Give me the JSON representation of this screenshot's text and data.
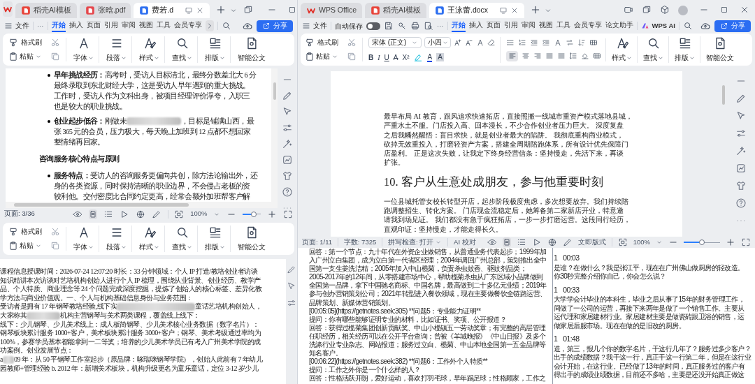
{
  "left_window": {
    "tabs": [
      {
        "label": "稻壳AI模板",
        "kind": "template",
        "selected": false
      },
      {
        "label": "张晗.pdf",
        "kind": "pdf",
        "selected": false
      },
      {
        "label": "费若.d",
        "kind": "word",
        "selected": true
      }
    ],
    "menu": {
      "file": "文件",
      "more": "···",
      "items": [
        {
          "label": "开始",
          "selected": true
        },
        {
          "label": "插入",
          "selected": false
        },
        {
          "label": "页面",
          "selected": false
        },
        {
          "label": "引用",
          "selected": false
        },
        {
          "label": "审阅",
          "selected": false
        },
        {
          "label": "视图",
          "selected": false
        },
        {
          "label": "工具",
          "selected": false
        },
        {
          "label": "会员专享",
          "selected": false
        }
      ],
      "share": "分享"
    },
    "ribbon": {
      "small": [
        "格式刷",
        "粘贴"
      ],
      "groups": [
        {
          "label": "字体",
          "kind": "font",
          "dropdown": true
        },
        {
          "label": "段落",
          "kind": "paragraph",
          "dropdown": true
        },
        {
          "label": "样式",
          "kind": "style",
          "dropdown": true
        },
        {
          "label": "查找",
          "kind": "find",
          "dropdown": true
        },
        {
          "label": "排版",
          "kind": "layout",
          "dropdown": true
        },
        {
          "label": "智能公文",
          "kind": "document",
          "dropdown": false
        }
      ]
    },
    "document": [
      {
        "kind": "bullet",
        "lines": [
          "**早年挑战经历：**高考时，受访人目标清北，最终分数差北大 6 分",
          "最终录取到东北财经大学，这是受访人早年遇到的重大挑战。",
          "工作时，受访人作为文科出身，被项目经理评价浮夸，入职三",
          "也是较大的职业挑战。"
        ]
      },
      {
        "kind": "bullet",
        "lines": [
          {
            "before": "**创业起步低谷：**刚做未",
            "after": "，目标是铺满山西，最"
          },
          "张 365 元的会员，压力极大，每天晚上加班到 12 点都不想回家",
          "整情绪再回家。"
        ]
      },
      {
        "kind": "heading",
        "text": "咨询服务核心特点与原则"
      },
      {
        "kind": "bullet",
        "lines": [
          "**服务特点：**受访人的咨询服务更偏向共创，除方法论输出外，还",
          "身的各类资源，同时保持清晰的职业边界，不会侵占老板的资",
          "较利他。交付密度比合同约定更高，经常会额外加班帮客户解"
        ]
      }
    ],
    "status_bar": {
      "page": "页面: 3/36",
      "zoom": "100%",
      "level": 0.6
    }
  },
  "right_window": {
    "tabs": [
      {
        "label": "WPS Office",
        "kind": "home",
        "selected": false
      },
      {
        "label": "稻壳AI模板",
        "kind": "template",
        "selected": false
      },
      {
        "label": "王泳蕾.docx",
        "kind": "word",
        "selected": true
      }
    ],
    "menu": {
      "file": "文件",
      "autosave": "自动保存",
      "autosave_on": false,
      "more": "···",
      "items": [
        {
          "label": "开始",
          "selected": true
        },
        {
          "label": "插入",
          "selected": false
        },
        {
          "label": "页面",
          "selected": false
        },
        {
          "label": "引用",
          "selected": false
        },
        {
          "label": "审阅",
          "selected": false
        },
        {
          "label": "视图",
          "selected": false
        },
        {
          "label": "工具",
          "selected": false
        },
        {
          "label": "会员专享",
          "selected": false
        },
        {
          "label": "论文助手",
          "selected": false
        }
      ],
      "ai": "WPS AI",
      "share": "分享"
    },
    "ribbon": {
      "small": [
        "格式刷",
        "粘贴"
      ],
      "font": "宋体 (正文)",
      "size": "小四",
      "format": [
        {
          "label": "B",
          "kind": "bold"
        },
        {
          "label": "I",
          "kind": "italic"
        },
        {
          "label": "U",
          "kind": "underline"
        },
        {
          "label": "A",
          "kind": "strike"
        },
        {
          "label": "X²",
          "kind": "plain"
        },
        {
          "label": "A",
          "kind": "color"
        },
        {
          "label": "A",
          "kind": "shading"
        }
      ],
      "groups": [
        {
          "label": "样式",
          "kind": "style",
          "dropdown": true
        },
        {
          "label": "查找",
          "kind": "find",
          "dropdown": true
        },
        {
          "label": "排版",
          "kind": "layout",
          "dropdown": true
        },
        {
          "label": "智能公文",
          "kind": "document",
          "dropdown": false
        }
      ]
    },
    "document": [
      {
        "kind": "paragraph",
        "lines": [
          "最早布局 AI 教育，跟风追求快速拓店，直接照搬一线城市重资产模式落地县城，",
          "严重水土不服。门店投入高、回本漫长，不少合作创业者压力巨大。 深度复盘",
          "之后我幡然醒悟：盲目求快，就是创业者最大的陷阱。 我彻底重构商业模式，",
          "砍掉无效重投入，打磨轻资产方案，搭建全周期陪跑体系，所有设计优先保障门",
          "店盈利。 正是这次失败，让我定下终身经营信条：坚持慢走，先活下来，再谈",
          "扩张。"
        ]
      },
      {
        "kind": "heading",
        "text": "10.  客户从生意处成朋友，参与他重要时刻"
      },
      {
        "kind": "paragraph",
        "lines": [
          "一位县城托管女校长转型开店，起步阶段极度焦虑，多次想要放弃。我们持续陪",
          "跑调整招生、转化方案。 门店现金流稳定后，她筹备第二家新店开业，特意邀",
          "请我到场见证。 我们都没有急于疯狂拓店，一步一步打磨运营。这段同行经历，",
          "直观印证：坚持慢走，才能走得长久。"
        ]
      }
    ],
    "status_bar": {
      "page": "页面: 1/11",
      "words": "字数: 7325",
      "spell": "拼写检查: 打开",
      "proof": "AI 校对",
      "mode": "文即版式",
      "zoom": "100%",
      "level": 0.5
    }
  },
  "lower_left_window": {
    "ribbon": {
      "small": [
        "格式刷",
        "粘贴"
      ],
      "groups": [
        {
          "label": "字体",
          "kind": "font",
          "dropdown": true
        },
        {
          "label": "段落",
          "kind": "paragraph",
          "dropdown": true
        },
        {
          "label": "样式",
          "kind": "style",
          "dropdown": true
        },
        {
          "label": "查找",
          "kind": "find",
          "dropdown": true
        },
        {
          "label": "排版",
          "kind": "layout",
          "dropdown": true
        },
        {
          "label": "智能公文",
          "kind": "document",
          "dropdown": false
        }
      ]
    },
    "document": [
      {
        "kind": "paragraph",
        "lines": [
          "课程信息授课时间：2026-07-24 12:07:20 时长：33  分钟领域：个人 IP 打造/教培创业者访谈",
          "知识精讲本次访谈对艺培机构创始人进行个人 IP 梳理，围绕从业背景、创业经历、教学产",
          "品、个人特质、商业理念等 24 个问题完成深度挖掘，提炼了创始人的核心标签、差异化教",
          "学方法与商业价值观。一、个人与机构基础信息身份与业务范围：",
          {
            "before": "受访者是拥有 17 年钢琴教培经验,线下实",
            "after": "童话艺培机构创始人，"
          },
          {
            "before": "大家称其",
            "after": "机构主营钢琴与美术两类课程，覆盖线上线下："
          },
          "线下：少儿钢琴、少儿美术线上：成人板简钢琴、少儿美术核心业务数据（数字名片）：",
          "钢琴板块累计服务 1000+客户，美术板块累计服务 3000+客户；钢琴、美术考级通过率均为",
          "100%，参赛学员基本都能拿到一二等奖；培养的少儿美术学员已有考入广州美术学院的成",
          "功案例。创业发展节点：",
          {
            "before": "a",
            "after": "09 年：从 50 平钢琴工作室起步（原品牌：哆瑞咪钢琴学院），创始人此前有 7 年幼儿"
          },
          "园教师+管理经验 b. 2012 年：新增美术板块，机构升级更名为童乐童话，定位 3-12 岁少儿"
        ]
      }
    ]
  },
  "notes_window": {
    "paragraphs": [
      {
        "lines": [
          "回答：第一个节点：九十年代在外资企业做销售，从普通业务代表起步；1999年加",
          "入广州立白集团，成为立白第一代省区经理；2004年调回广州总部，策划推出全中",
          "国第一支生姜洗洁精；2005年加入中山榄菊，负责杀虫蚊香、驱蚊剂品类；",
          "2005-2017年的12年间，从零搭建市场中心，帮助榄菊杀虫从广东区域小品牌做到",
          "全国第一品牌，拿下中国驰名商标、中国名牌，最高做到二十多亿元业绩；2019年",
          "参与创办营销策划公司；2021年转型进入餐饮领域，现在主要做餐饮全链路运营、",
          "品牌策划、新媒体营销策划。"
        ]
      },
      {
        "lines": [
          "[00:05:05](https://getnotes.seek:305) **问题5：专业能力证明**"
        ]
      },
      {
        "lines": [
          "提问：你有哪些能够证明专业的材料，比如证书、奖项、公开报道？"
        ]
      },
      {
        "lines": [
          "回答：获得过榄菊集团创新贡献奖、中山小榄镇五一劳动奖章；有完整的高层管理",
          "任职经历，相关经历可以在公开平台查询；曾被《羊城晚报》《中山日报》及多个",
          "洗涤行业专业杂志、网站报道；服务过立白、榄菊、中山本地全国第一五金品牌等",
          "知名客户。"
        ]
      },
      {
        "lines": [
          "[00:06:22](https://getnotes.seek:382) **问题6：工作外个人特质**"
        ]
      },
      {
        "lines": [
          "提问：工作之外你是一个什么样的人？"
        ]
      },
      {
        "lines": [
          "回答：性格活跃开朗，爱好运动，喜欢打羽毛球，早年踢足球；性格顾家，工作之"
        ]
      }
    ]
  },
  "transcript_window": {
    "entries": [
      {
        "speaker": "1",
        "time": "00:03",
        "lines": [
          "是谁？在做什么？我是张江平，现在在广州佛山做厨房的轻改造。",
          "你30秒完整介绍你自己，你会怎么说？"
        ]
      },
      {
        "speaker": "1",
        "time": "00:33",
        "lines": [
          "大学学会计毕业的本科生，毕业之后从事了15年的财务管理工作，",
          "间做了一公司的运营，再接下来两年是做了一个销售工作。主要从",
          "运代理和家居建材行业。家居建材主要是做瓷砖跟卫浴的销售，运",
          "做家居后服市场。现在在做的是旧改的厨房。"
        ]
      },
      {
        "speaker": "1",
        "time": "01:48",
        "lines": [
          "造，第三，报几个你的数字名片，干这行几年了？服务过多少客户？",
          "出手的成绩数据？我干这一行，真正干这一行第二年，但是在这行业",
          "会计开始，在这行业。已经做了13年的时间，真正服务过的客户有",
          "得出手的成绩业绩数据，目前还不多哈，主要是还没开始真正做这"
        ]
      }
    ]
  }
}
